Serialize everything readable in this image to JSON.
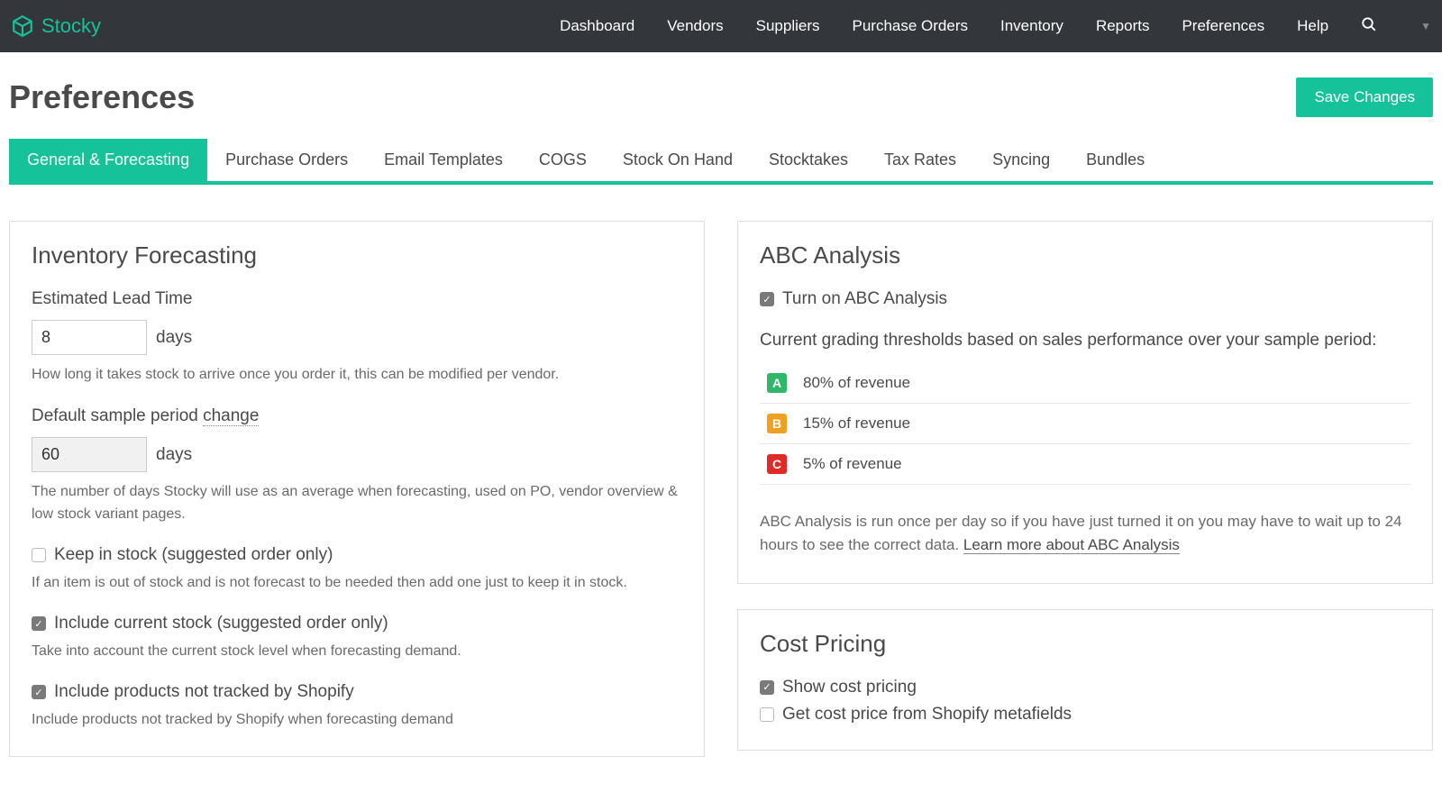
{
  "brand": "Stocky",
  "nav": {
    "items": [
      "Dashboard",
      "Vendors",
      "Suppliers",
      "Purchase Orders",
      "Inventory",
      "Reports",
      "Preferences",
      "Help"
    ]
  },
  "header": {
    "title": "Preferences",
    "save_label": "Save Changes"
  },
  "tabs": [
    "General & Forecasting",
    "Purchase Orders",
    "Email Templates",
    "COGS",
    "Stock On Hand",
    "Stocktakes",
    "Tax Rates",
    "Syncing",
    "Bundles"
  ],
  "forecasting": {
    "title": "Inventory Forecasting",
    "lead_time_label": "Estimated Lead Time",
    "lead_time_value": "8",
    "days": "days",
    "lead_time_help": "How long it takes stock to arrive once you order it, this can be modified per vendor.",
    "sample_label_prefix": "Default sample period ",
    "sample_change": "change",
    "sample_value": "60",
    "sample_help": "The number of days Stocky will use as an average when forecasting, used on PO, vendor overview & low stock variant pages.",
    "keep_in_stock_label": "Keep in stock (suggested order only)",
    "keep_in_stock_help": "If an item is out of stock and is not forecast to be needed then add one just to keep it in stock.",
    "include_current_label": "Include current stock (suggested order only)",
    "include_current_help": "Take into account the current stock level when forecasting demand.",
    "include_untracked_label": "Include products not tracked by Shopify",
    "include_untracked_help": "Include products not tracked by Shopify when forecasting demand"
  },
  "abc": {
    "title": "ABC Analysis",
    "enable_label": "Turn on ABC Analysis",
    "desc": "Current grading thresholds based on sales performance over your sample period:",
    "a": "80% of revenue",
    "b": "15% of revenue",
    "c": "5% of revenue",
    "note_prefix": "ABC Analysis is run once per day so if you have just turned it on you may have to wait up to 24 hours to see the correct data. ",
    "learn_more": "Learn more about ABC Analysis"
  },
  "cost": {
    "title": "Cost Pricing",
    "show_label": "Show cost pricing",
    "metafields_label": "Get cost price from Shopify metafields"
  }
}
